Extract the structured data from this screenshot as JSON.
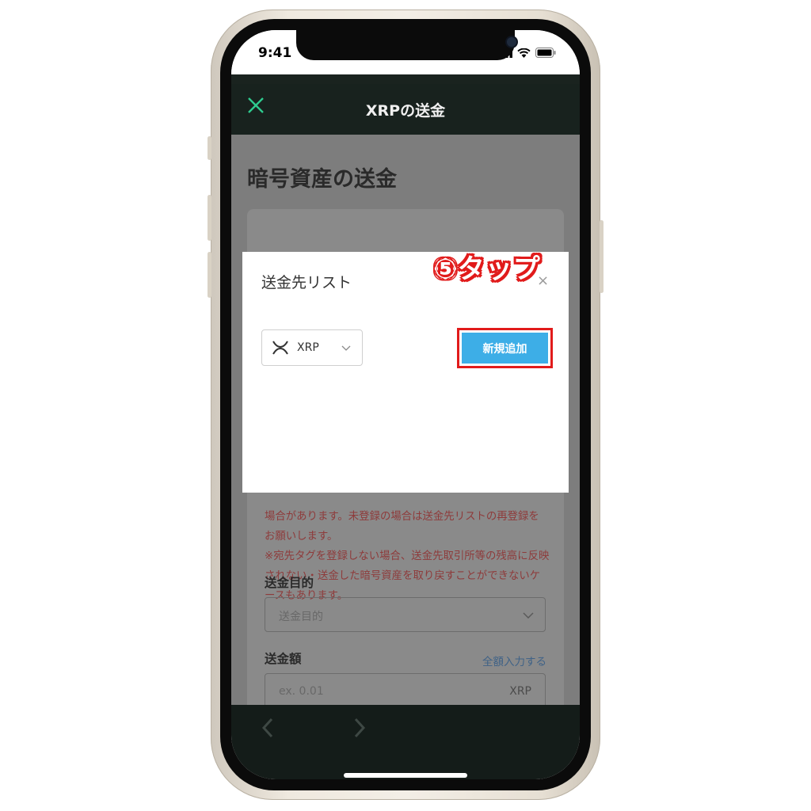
{
  "status_bar": {
    "time": "9:41"
  },
  "app": {
    "title": "XRPの送金",
    "page_heading": "暗号資産の送金",
    "warning_text": "場合があります。未登録の場合は送金先リストの再登録をお願いします。\n※宛先タグを登録しない場合、送金先取引所等の残高に反映されない・送金した暗号資産を取り戻すことができないケースもあります。",
    "purpose_label": "送金目的",
    "purpose_placeholder": "送金目的",
    "amount_label": "送金額",
    "fill_all_link": "全額入力する",
    "amount_placeholder": "ex. 0.01",
    "amount_unit": "XRP"
  },
  "modal": {
    "title": "送金先リスト",
    "close_glyph": "×",
    "coin_select": "XRP",
    "new_button": "新規追加"
  },
  "annotation": {
    "label": "⑤タップ"
  },
  "colors": {
    "app_header": "#18221e",
    "overlay": "#7d7d7d",
    "accent_green": "#2ecc8f",
    "button_blue": "#3daee7",
    "highlight_red": "#e11b1b",
    "warning_red": "#8e3b3b"
  },
  "icons": [
    "close-icon",
    "xrp-logo-icon",
    "chevron-down-icon",
    "back-arrow-icon",
    "forward-arrow-icon",
    "signal-icon",
    "wifi-icon",
    "battery-icon"
  ]
}
